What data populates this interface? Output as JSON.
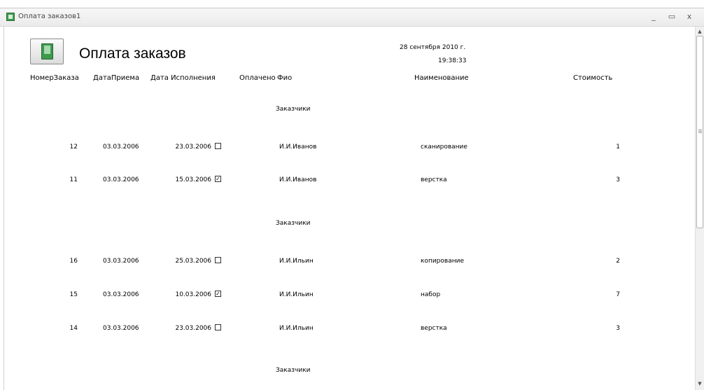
{
  "window": {
    "title": "Оплата заказов1",
    "minimize_glyph": "_",
    "maximize_glyph": "▭",
    "close_glyph": "x"
  },
  "report": {
    "title": "Оплата заказов",
    "date": "28 сентября 2010 г.",
    "time": "19:38:33",
    "icon": "report-book-icon"
  },
  "columns": {
    "order_no": "НомерЗаказа",
    "received": "ДатаПриема",
    "completed": "Дата Исполнения",
    "paid": "Оплачено",
    "fio": "Фио",
    "name": "Наименование",
    "cost": "Стоимость"
  },
  "groups": [
    {
      "label": "Заказчики",
      "rows": [
        {
          "order_no": "12",
          "received": "03.03.2006",
          "completed": "23.03.2006",
          "paid": false,
          "fio": "И.И.Иванов",
          "name": "сканирование",
          "cost": "1"
        },
        {
          "order_no": "11",
          "received": "03.03.2006",
          "completed": "15.03.2006",
          "paid": true,
          "fio": "И.И.Иванов",
          "name": "верстка",
          "cost": "3"
        }
      ]
    },
    {
      "label": "Заказчики",
      "rows": [
        {
          "order_no": "16",
          "received": "03.03.2006",
          "completed": "25.03.2006",
          "paid": false,
          "fio": "И.И.Ильин",
          "name": "копирование",
          "cost": "2"
        },
        {
          "order_no": "15",
          "received": "03.03.2006",
          "completed": "10.03.2006",
          "paid": true,
          "fio": "И.И.Ильин",
          "name": "набор",
          "cost": "7"
        },
        {
          "order_no": "14",
          "received": "03.03.2006",
          "completed": "23.03.2006",
          "paid": false,
          "fio": "И.И.Ильин",
          "name": "верстка",
          "cost": "3"
        }
      ]
    },
    {
      "label": "Заказчики",
      "rows": []
    }
  ]
}
